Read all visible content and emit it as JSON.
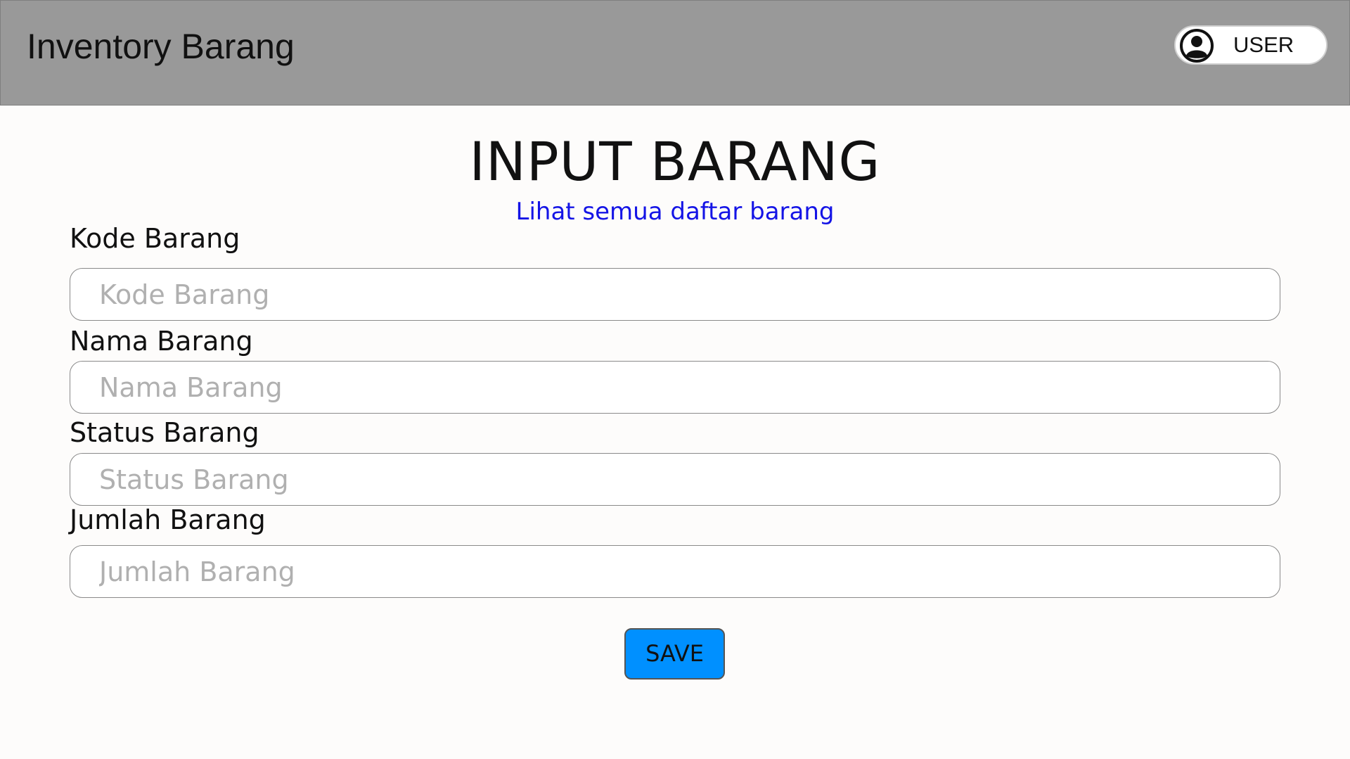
{
  "header": {
    "app_title": "Inventory Barang",
    "user_label": "USER",
    "user_icon": "user-avatar-icon"
  },
  "main": {
    "title": "INPUT BARANG",
    "list_link": "Lihat semua daftar barang",
    "fields": [
      {
        "label": "Kode Barang",
        "placeholder": "Kode Barang",
        "value": ""
      },
      {
        "label": "Nama Barang",
        "placeholder": "Nama Barang",
        "value": ""
      },
      {
        "label": "Status Barang",
        "placeholder": "Status Barang",
        "value": ""
      },
      {
        "label": "Jumlah Barang",
        "placeholder": "Jumlah Barang",
        "value": ""
      }
    ],
    "save_label": "SAVE"
  },
  "colors": {
    "header_bg": "#999999",
    "page_bg": "#fdfcfb",
    "link": "#1414e6",
    "save_button": "#0090ff"
  }
}
